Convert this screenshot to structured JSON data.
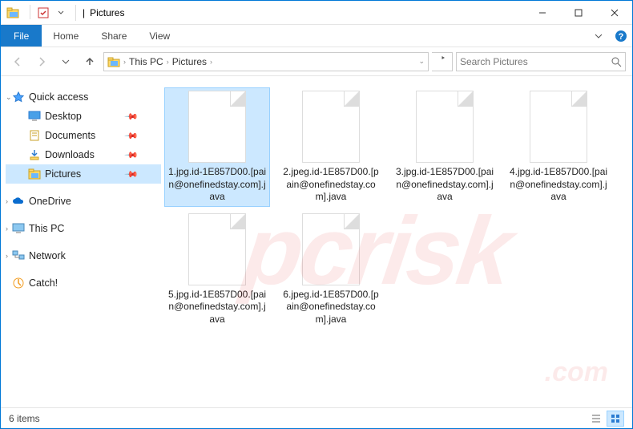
{
  "window": {
    "title": "Pictures",
    "titlebar_separator": "|"
  },
  "ribbon": {
    "file": "File",
    "tabs": [
      "Home",
      "Share",
      "View"
    ]
  },
  "address": {
    "crumbs": [
      "This PC",
      "Pictures"
    ],
    "search_placeholder": "Search Pictures"
  },
  "sidebar": {
    "quick_access": {
      "label": "Quick access",
      "items": [
        {
          "label": "Desktop",
          "pinned": true
        },
        {
          "label": "Documents",
          "pinned": true
        },
        {
          "label": "Downloads",
          "pinned": true
        },
        {
          "label": "Pictures",
          "pinned": true,
          "selected": true
        }
      ]
    },
    "onedrive": {
      "label": "OneDrive"
    },
    "thispc": {
      "label": "This PC"
    },
    "network": {
      "label": "Network"
    },
    "catch": {
      "label": "Catch!"
    }
  },
  "files": [
    {
      "name": "1.jpg.id-1E857D00.[pain@onefinedstay.com].java",
      "selected": true
    },
    {
      "name": "2.jpeg.id-1E857D00.[pain@onefinedstay.com].java"
    },
    {
      "name": "3.jpg.id-1E857D00.[pain@onefinedstay.com].java"
    },
    {
      "name": "4.jpg.id-1E857D00.[pain@onefinedstay.com].java"
    },
    {
      "name": "5.jpg.id-1E857D00.[pain@onefinedstay.com].java"
    },
    {
      "name": "6.jpeg.id-1E857D00.[pain@onefinedstay.com].java"
    }
  ],
  "status": {
    "count_text": "6 items"
  },
  "watermark": {
    "main": "pcrisk",
    "sub": ".com"
  }
}
